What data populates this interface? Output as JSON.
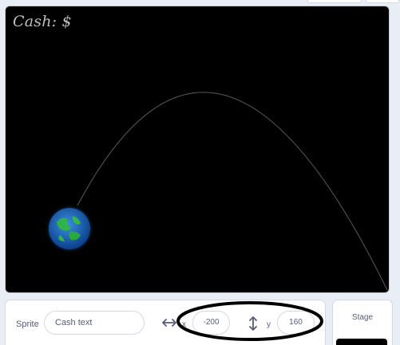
{
  "stage": {
    "cash_label": "Cash: $",
    "background_color": "#000000",
    "trajectory_color": "#5a5a5a",
    "planet_icon": "earth-globe-icon"
  },
  "sprite_info": {
    "sprite_label": "Sprite",
    "sprite_name": "Cash text",
    "x_label": "x",
    "x_value": "-200",
    "y_label": "y",
    "y_value": "160",
    "x_icon": "horizontal-arrows-icon",
    "y_icon": "vertical-arrows-icon"
  },
  "stage_panel": {
    "label": "Stage"
  },
  "annotation": {
    "color": "#000000"
  }
}
